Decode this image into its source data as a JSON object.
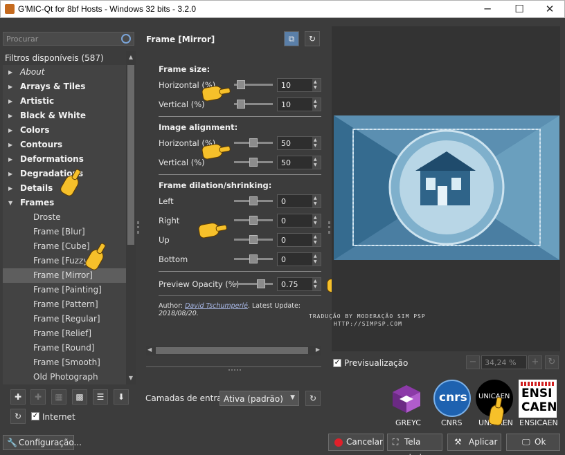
{
  "window": {
    "title": "G'MIC-Qt for 8bf Hosts - Windows 32 bits - 3.2.0",
    "minimize": "─",
    "maximize": "☐",
    "close": "✕"
  },
  "sidebar": {
    "search_placeholder": "Procurar",
    "header": "Filtros disponíveis (587)",
    "categories": [
      {
        "label": "About",
        "style": "about"
      },
      {
        "label": "Arrays & Tiles"
      },
      {
        "label": "Artistic"
      },
      {
        "label": "Black & White"
      },
      {
        "label": "Colors"
      },
      {
        "label": "Contours"
      },
      {
        "label": "Deformations"
      },
      {
        "label": "Degradations"
      },
      {
        "label": "Details"
      },
      {
        "label": "Frames",
        "expanded": true
      }
    ],
    "frames_items": [
      "Droste",
      "Frame [Blur]",
      "Frame [Cube]",
      "Frame [Fuzzy]",
      "Frame [Mirror]",
      "Frame [Painting]",
      "Frame [Pattern]",
      "Frame [Regular]",
      "Frame [Relief]",
      "Frame [Round]",
      "Frame [Smooth]",
      "Old Photograph"
    ],
    "selected": "Frame [Mirror]",
    "internet_label": "Internet",
    "settings_label": "Configuração..."
  },
  "filter": {
    "title": "Frame [Mirror]",
    "sections": {
      "frame_size": "Frame size:",
      "image_alignment": "Image alignment:",
      "dilation": "Frame dilation/shrinking:"
    },
    "params": {
      "fs_h": {
        "label": "Horizontal (%)",
        "value": "10",
        "level": 0.1
      },
      "fs_v": {
        "label": "Vertical (%)",
        "value": "10",
        "level": 0.1
      },
      "ia_h": {
        "label": "Horizontal (%)",
        "value": "50",
        "level": 0.5
      },
      "ia_v": {
        "label": "Vertical (%)",
        "value": "50",
        "level": 0.5
      },
      "left": {
        "label": "Left",
        "value": "0",
        "level": 0.5
      },
      "right": {
        "label": "Right",
        "value": "0",
        "level": 0.5
      },
      "up": {
        "label": "Up",
        "value": "0",
        "level": 0.5
      },
      "bottom": {
        "label": "Bottom",
        "value": "0",
        "level": 0.5
      },
      "opacity": {
        "label": "Preview Opacity (%)",
        "value": "0.75",
        "level": 0.75
      }
    },
    "author_prefix": "Author:",
    "author_name": "David Tschumperlé",
    "author_suffix": ".",
    "update_label": "Latest Update:",
    "update_date": "2018/08/20."
  },
  "input_layers": {
    "label": "Camadas de entrada",
    "value": "Ativa (padrão)"
  },
  "preview": {
    "checkbox_label": "Previsualização",
    "zoom_value": "34,24 %",
    "watermark_line1": "TRADUÇÃO BY MODERAÇÃO SIM PSP",
    "watermark_line2": "HTTP://SIMPSP.COM"
  },
  "logos": {
    "greyc": "GREYC",
    "cnrs": "CNRS",
    "unicaen": "UNICAEN",
    "ensicaen": "ENSICAEN",
    "cnrs_mark": "cnrs",
    "unicaen_mark": "UNICAEN",
    "ensicaen_mark1": "ENSI",
    "ensicaen_mark2": "CAEN"
  },
  "buttons": {
    "cancel": "Cancelar",
    "fullscreen": "Tela cheia",
    "apply": "Aplicar",
    "ok": "Ok"
  },
  "colors": {
    "accent": "#7aa4d8",
    "cancel_red": "#e0202a",
    "bg": "#3c3c3c"
  }
}
